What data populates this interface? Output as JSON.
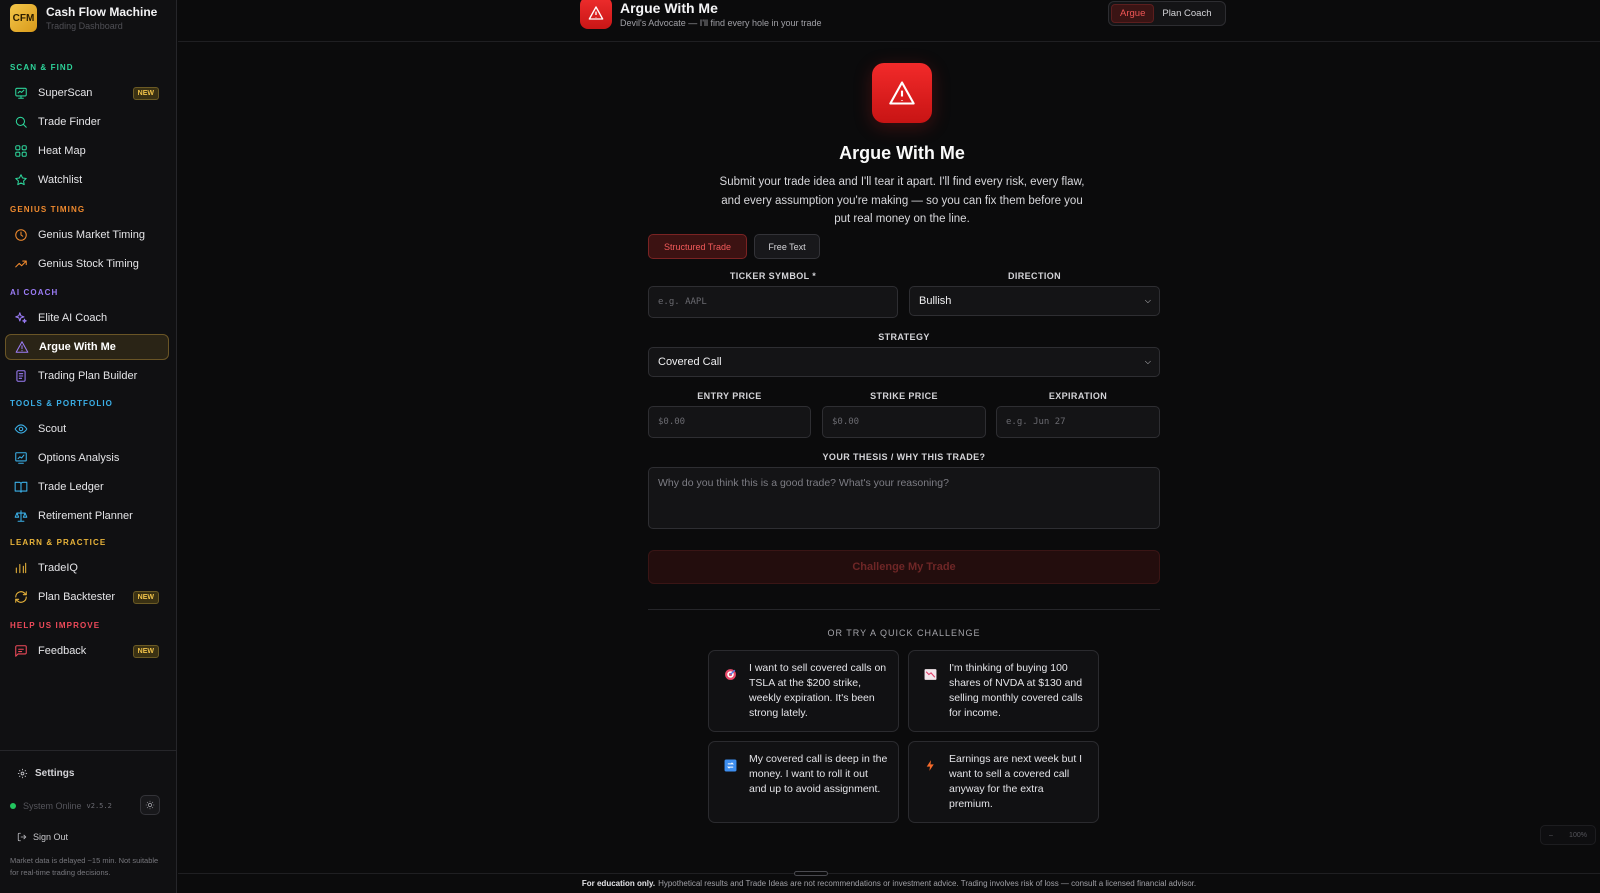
{
  "brand": {
    "logo": "CFM",
    "name": "Cash Flow Machine",
    "subtitle": "Trading Dashboard"
  },
  "sidebar": {
    "sections": [
      {
        "title": "SCAN & FIND",
        "color": "#2dd49a",
        "items": [
          {
            "label": "SuperScan",
            "icon": "scan-icon",
            "badge": "NEW"
          },
          {
            "label": "Trade Finder",
            "icon": "search-icon"
          },
          {
            "label": "Heat Map",
            "icon": "grid-icon"
          },
          {
            "label": "Watchlist",
            "icon": "star-icon"
          }
        ]
      },
      {
        "title": "GENIUS TIMING",
        "color": "#f08a2e",
        "items": [
          {
            "label": "Genius Market Timing",
            "icon": "clock-icon"
          },
          {
            "label": "Genius Stock Timing",
            "icon": "trending-up-icon"
          }
        ]
      },
      {
        "title": "AI COACH",
        "color": "#9b7cf6",
        "items": [
          {
            "label": "Elite AI Coach",
            "icon": "sparkles-icon"
          },
          {
            "label": "Argue With Me",
            "icon": "warning-icon",
            "active": true
          },
          {
            "label": "Trading Plan Builder",
            "icon": "document-icon"
          }
        ]
      },
      {
        "title": "TOOLS & PORTFOLIO",
        "color": "#3bb0e8",
        "items": [
          {
            "label": "Scout",
            "icon": "eye-icon"
          },
          {
            "label": "Options Analysis",
            "icon": "chart-icon"
          },
          {
            "label": "Trade Ledger",
            "icon": "book-icon"
          },
          {
            "label": "Retirement Planner",
            "icon": "scale-icon"
          }
        ]
      },
      {
        "title": "LEARN & PRACTICE",
        "color": "#e9b43a",
        "items": [
          {
            "label": "TradeIQ",
            "icon": "bar-chart-icon"
          },
          {
            "label": "Plan Backtester",
            "icon": "refresh-icon",
            "badge": "NEW"
          }
        ]
      },
      {
        "title": "HELP US IMPROVE",
        "color": "#ef4a5a",
        "items": [
          {
            "label": "Feedback",
            "icon": "message-icon",
            "badge": "NEW"
          }
        ]
      }
    ],
    "settings_label": "Settings",
    "status_label": "System Online",
    "version": "v2.5.2",
    "signout_label": "Sign Out",
    "disclaimer": "Market data is delayed ~15 min. Not suitable for real-time trading decisions."
  },
  "header": {
    "title": "Argue With Me",
    "subtitle": "Devil's Advocate — I'll find every hole in your trade",
    "tabs": [
      "Argue",
      "Plan Coach"
    ],
    "active_tab": "Argue"
  },
  "main": {
    "title": "Argue With Me",
    "description": "Submit your trade idea and I'll tear it apart. I'll find every risk, every flaw, and every assumption you're making — so you can fix them before you put real money on the line.",
    "modes": [
      "Structured Trade",
      "Free Text"
    ],
    "active_mode": "Structured Trade",
    "form": {
      "ticker_label": "TICKER SYMBOL *",
      "ticker_placeholder": "e.g. AAPL",
      "direction_label": "DIRECTION",
      "direction_value": "Bullish",
      "strategy_label": "STRATEGY",
      "strategy_value": "Covered Call",
      "entry_label": "ENTRY PRICE",
      "entry_placeholder": "$0.00",
      "strike_label": "STRIKE PRICE",
      "strike_placeholder": "$0.00",
      "expiration_label": "EXPIRATION",
      "expiration_placeholder": "e.g. Jun 27",
      "thesis_label": "YOUR THESIS / WHY THIS TRADE?",
      "thesis_placeholder": "Why do you think this is a good trade? What's your reasoning?",
      "submit_label": "Challenge My Trade"
    },
    "quick_heading": "OR TRY A QUICK CHALLENGE",
    "quick_challenges": [
      {
        "icon": "target-icon",
        "text": "I want to sell covered calls on TSLA at the $200 strike, weekly expiration. It's been strong lately."
      },
      {
        "icon": "chart-down-icon",
        "text": "I'm thinking of buying 100 shares of NVDA at $130 and selling monthly covered calls for income."
      },
      {
        "icon": "repeat-icon",
        "text": "My covered call is deep in the money. I want to roll it out and up to avoid assignment."
      },
      {
        "icon": "lightning-icon",
        "text": "Earnings are next week but I want to sell a covered call anyway for the extra premium."
      }
    ]
  },
  "footer": {
    "bold": "For education only.",
    "text": "Hypothetical results and Trade Ideas are not recommendations or investment advice. Trading involves risk of loss — consult a licensed financial advisor."
  },
  "zoom": {
    "minus": "–",
    "level": "100%"
  }
}
